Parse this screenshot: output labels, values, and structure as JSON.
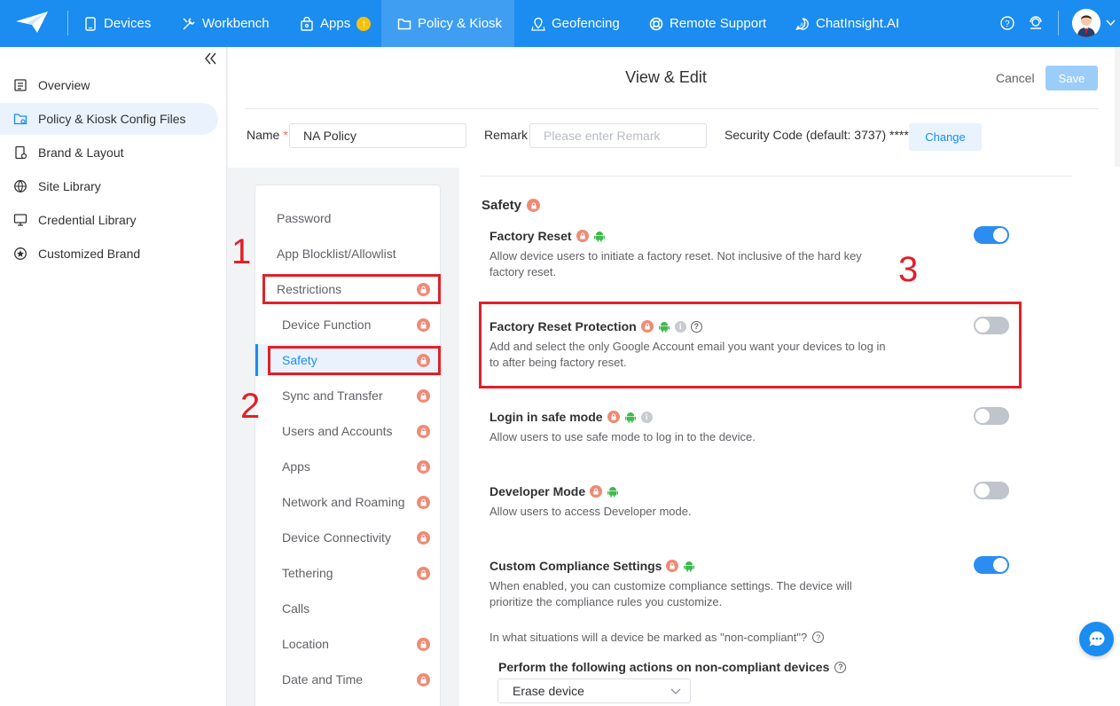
{
  "nav": {
    "items": [
      {
        "label": "Devices",
        "icon": "tablet-icon"
      },
      {
        "label": "Workbench",
        "icon": "tools-icon"
      },
      {
        "label": "Apps",
        "icon": "bag-icon",
        "badge": "↑"
      },
      {
        "label": "Policy & Kiosk",
        "icon": "folder-icon",
        "active": true
      },
      {
        "label": "Geofencing",
        "icon": "map-icon"
      },
      {
        "label": "Remote Support",
        "icon": "lifebuoy-icon"
      },
      {
        "label": "ChatInsight.AI",
        "icon": "ai-chat-icon"
      }
    ],
    "accent": "#1b8cf0"
  },
  "sidebar": {
    "items": [
      {
        "label": "Overview",
        "icon": "list-icon"
      },
      {
        "label": "Policy & Kiosk Config Files",
        "icon": "folder-gear-icon",
        "active": true
      },
      {
        "label": "Brand & Layout",
        "icon": "phone-layout-icon"
      },
      {
        "label": "Site Library",
        "icon": "globe-icon"
      },
      {
        "label": "Credential Library",
        "icon": "monitor-icon"
      },
      {
        "label": "Customized Brand",
        "icon": "star-circle-icon"
      }
    ]
  },
  "header": {
    "title": "View & Edit",
    "cancel": "Cancel",
    "save": "Save",
    "name_label": "Name",
    "name_required": "*",
    "name_value": "NA Policy",
    "remark_label": "Remark",
    "remark_placeholder": "Please enter Remark",
    "security_label": "Security Code (default: 3737) ****",
    "change": "Change"
  },
  "submenu": {
    "items": [
      {
        "label": "Password"
      },
      {
        "label": "App Blocklist/Allowlist"
      },
      {
        "label": "Restrictions",
        "lock": true
      },
      {
        "label": "Device Function",
        "lock": true
      },
      {
        "label": "Safety",
        "lock": true,
        "active": true
      },
      {
        "label": "Sync and Transfer",
        "lock": true
      },
      {
        "label": "Users and Accounts",
        "lock": true
      },
      {
        "label": "Apps",
        "lock": true
      },
      {
        "label": "Network and Roaming",
        "lock": true
      },
      {
        "label": "Device Connectivity",
        "lock": true
      },
      {
        "label": "Tethering",
        "lock": true
      },
      {
        "label": "Calls"
      },
      {
        "label": "Location",
        "lock": true
      },
      {
        "label": "Date and Time",
        "lock": true
      }
    ]
  },
  "content": {
    "section_title": "Safety",
    "settings": [
      {
        "title": "Factory Reset",
        "desc": "Allow device users to initiate a factory reset. Not inclusive of the hard key factory reset.",
        "enabled": true
      },
      {
        "title": "Factory Reset Protection",
        "desc": "Add and select the only Google Account email you want your devices to log in to after being factory reset.",
        "enabled": false
      },
      {
        "title": "Login in safe mode",
        "desc": "Allow users to use safe mode to log in to the device.",
        "enabled": false
      },
      {
        "title": "Developer Mode",
        "desc": "Allow users to access Developer mode.",
        "enabled": false
      },
      {
        "title": "Custom Compliance Settings",
        "desc": "When enabled, you can customize compliance settings. The device will prioritize the compliance rules you customize.",
        "enabled": true
      }
    ],
    "question": "In what situations will a device be marked as \"non-compliant\"?",
    "actions_title": "Perform the following actions on non-compliant devices",
    "action_select": "Erase device"
  },
  "annotations": {
    "one": "1",
    "two": "2",
    "three": "3",
    "color": "#e0202a"
  }
}
